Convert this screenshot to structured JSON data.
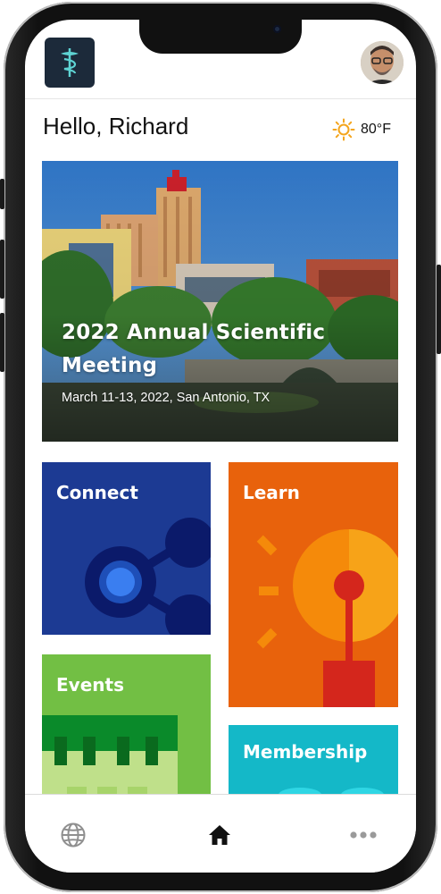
{
  "header": {
    "logo_icon": "caduceus-icon",
    "avatar_icon": "user-avatar"
  },
  "greeting": "Hello, Richard",
  "weather": {
    "icon": "sun-icon",
    "temperature": "80°F"
  },
  "hero": {
    "title_line1": "2022 Annual Scientific",
    "title_line2": "Meeting",
    "subtitle": "March 11-13, 2022, San Antonio, TX"
  },
  "tiles": [
    {
      "label": "Connect",
      "color": "#1c3a93",
      "icon": "network-icon"
    },
    {
      "label": "Learn",
      "color": "#e8620c",
      "icon": "lightbulb-icon"
    },
    {
      "label": "Events",
      "color": "#72bf44",
      "icon": "calendar-icon"
    },
    {
      "label": "Membership",
      "color": "#14b8c8",
      "icon": "membership-icon"
    }
  ],
  "nav": [
    {
      "icon": "globe-icon",
      "active": false
    },
    {
      "icon": "home-icon",
      "active": true
    },
    {
      "icon": "more-icon",
      "active": false
    }
  ]
}
